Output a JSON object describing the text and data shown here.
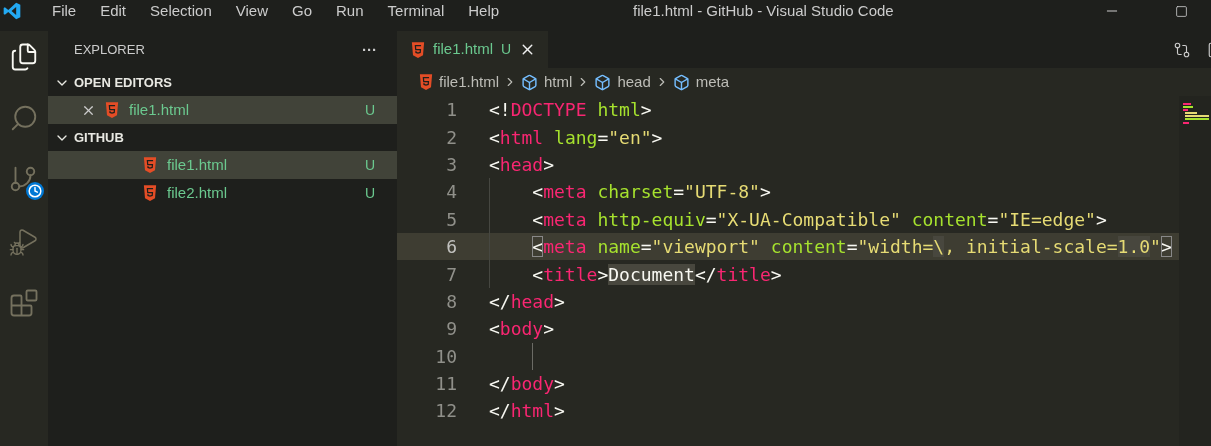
{
  "window": {
    "title": "file1.html - GitHub - Visual Studio Code"
  },
  "menu": [
    "File",
    "Edit",
    "Selection",
    "View",
    "Go",
    "Run",
    "Terminal",
    "Help"
  ],
  "activity_bar": [
    {
      "kind": "explorer",
      "selected": true
    },
    {
      "kind": "search",
      "selected": false
    },
    {
      "kind": "source_control",
      "selected": false
    },
    {
      "kind": "debug",
      "selected": false
    },
    {
      "kind": "extensions",
      "selected": false
    }
  ],
  "sidebar": {
    "title": "EXPLORER",
    "more": "···",
    "sections": [
      {
        "title": "OPEN EDITORS",
        "expanded": true,
        "items": [
          {
            "name": "file1.html",
            "status": "U",
            "closable": true,
            "selected": true
          }
        ]
      },
      {
        "title": "GITHUB",
        "expanded": true,
        "items": [
          {
            "name": "file1.html",
            "status": "U",
            "closable": false,
            "selected": true
          },
          {
            "name": "file2.html",
            "status": "U",
            "closable": false,
            "selected": false
          }
        ]
      }
    ]
  },
  "tabs": [
    {
      "label": "file1.html",
      "status": "U",
      "selected": true
    }
  ],
  "breadcrumb": [
    {
      "kind": "file",
      "label": "file1.html"
    },
    {
      "kind": "element",
      "label": "html"
    },
    {
      "kind": "element",
      "label": "head"
    },
    {
      "kind": "element",
      "label": "meta"
    }
  ],
  "lines": [
    {
      "number": "1",
      "current": false,
      "indented": false,
      "tokens": [
        {
          "kind": "punct",
          "text": "<!",
          "highlighted": false
        },
        {
          "kind": "tag",
          "text": "DOCTYPE",
          "highlighted": false
        },
        {
          "kind": "attr",
          "text": " html",
          "highlighted": false
        },
        {
          "kind": "punct",
          "text": ">",
          "highlighted": false
        }
      ]
    },
    {
      "number": "2",
      "current": false,
      "indented": false,
      "tokens": [
        {
          "kind": "punct",
          "text": "<",
          "highlighted": false
        },
        {
          "kind": "tag",
          "text": "html",
          "highlighted": false
        },
        {
          "kind": "attr",
          "text": " lang",
          "highlighted": false
        },
        {
          "kind": "punct",
          "text": "=",
          "highlighted": false
        },
        {
          "kind": "str",
          "text": "\"en\"",
          "highlighted": false
        },
        {
          "kind": "punct",
          "text": ">",
          "highlighted": false
        }
      ]
    },
    {
      "number": "3",
      "current": false,
      "indented": false,
      "tokens": [
        {
          "kind": "punct",
          "text": "<",
          "highlighted": false
        },
        {
          "kind": "tag",
          "text": "head",
          "highlighted": false
        },
        {
          "kind": "punct",
          "text": ">",
          "highlighted": false
        }
      ]
    },
    {
      "number": "4",
      "current": false,
      "indented": true,
      "tokens": [
        {
          "kind": "punct",
          "text": "<",
          "highlighted": false
        },
        {
          "kind": "tag",
          "text": "meta",
          "highlighted": false
        },
        {
          "kind": "attr",
          "text": " charset",
          "highlighted": false
        },
        {
          "kind": "punct",
          "text": "=",
          "highlighted": false
        },
        {
          "kind": "str",
          "text": "\"UTF-8\"",
          "highlighted": false
        },
        {
          "kind": "punct",
          "text": ">",
          "highlighted": false
        }
      ]
    },
    {
      "number": "5",
      "current": false,
      "indented": true,
      "tokens": [
        {
          "kind": "punct",
          "text": "<",
          "highlighted": false
        },
        {
          "kind": "tag",
          "text": "meta",
          "highlighted": false
        },
        {
          "kind": "attr",
          "text": " http-equiv",
          "highlighted": false
        },
        {
          "kind": "punct",
          "text": "=",
          "highlighted": false
        },
        {
          "kind": "str",
          "text": "\"X-UA-Compatible\"",
          "highlighted": false
        },
        {
          "kind": "attr",
          "text": " content",
          "highlighted": false
        },
        {
          "kind": "punct",
          "text": "=",
          "highlighted": false
        },
        {
          "kind": "str",
          "text": "\"IE=edge\"",
          "highlighted": false
        },
        {
          "kind": "punct",
          "text": ">",
          "highlighted": false
        }
      ]
    },
    {
      "number": "6",
      "current": true,
      "indented": true,
      "tokens": [
        {
          "kind": "bracket",
          "text": "<",
          "highlighted": false
        },
        {
          "kind": "tag",
          "text": "meta",
          "highlighted": false
        },
        {
          "kind": "attr",
          "text": " name",
          "highlighted": false
        },
        {
          "kind": "punct",
          "text": "=",
          "highlighted": false
        },
        {
          "kind": "str",
          "text": "\"viewport\"",
          "highlighted": false
        },
        {
          "kind": "attr",
          "text": " content",
          "highlighted": false
        },
        {
          "kind": "punct",
          "text": "=",
          "highlighted": false
        },
        {
          "kind": "str",
          "text": "\"width=",
          "highlighted": false
        },
        {
          "kind": "str",
          "text": "\\",
          "highlighted": true
        },
        {
          "kind": "str",
          "text": ", initial-scale=",
          "highlighted": false
        },
        {
          "kind": "str",
          "text": "1.0",
          "highlighted": true
        },
        {
          "kind": "str",
          "text": "\"",
          "highlighted": false
        },
        {
          "kind": "bracket",
          "text": ">",
          "highlighted": false
        }
      ]
    },
    {
      "number": "7",
      "current": false,
      "indented": true,
      "tokens": [
        {
          "kind": "punct",
          "text": "<",
          "highlighted": false
        },
        {
          "kind": "tag",
          "text": "title",
          "highlighted": false
        },
        {
          "kind": "punct",
          "text": ">",
          "highlighted": false
        },
        {
          "kind": "text",
          "text": "Document",
          "highlighted": true
        },
        {
          "kind": "punct",
          "text": "</",
          "highlighted": false
        },
        {
          "kind": "tag",
          "text": "title",
          "highlighted": false
        },
        {
          "kind": "punct",
          "text": ">",
          "highlighted": false
        }
      ]
    },
    {
      "number": "8",
      "current": false,
      "indented": false,
      "tokens": [
        {
          "kind": "punct",
          "text": "</",
          "highlighted": false
        },
        {
          "kind": "tag",
          "text": "head",
          "highlighted": false
        },
        {
          "kind": "punct",
          "text": ">",
          "highlighted": false
        }
      ]
    },
    {
      "number": "9",
      "current": false,
      "indented": false,
      "tokens": [
        {
          "kind": "punct",
          "text": "<",
          "highlighted": false
        },
        {
          "kind": "tag",
          "text": "body",
          "highlighted": false
        },
        {
          "kind": "punct",
          "text": ">",
          "highlighted": false
        }
      ]
    },
    {
      "number": "10",
      "current": false,
      "indented": true
    },
    {
      "number": "11",
      "current": false,
      "indented": false,
      "tokens": [
        {
          "kind": "punct",
          "text": "</",
          "highlighted": false
        },
        {
          "kind": "tag",
          "text": "body",
          "highlighted": false
        },
        {
          "kind": "punct",
          "text": ">",
          "highlighted": false
        }
      ]
    },
    {
      "number": "12",
      "current": false,
      "indented": false,
      "tokens": [
        {
          "kind": "punct",
          "text": "</",
          "highlighted": false
        },
        {
          "kind": "tag",
          "text": "html",
          "highlighted": false
        },
        {
          "kind": "punct",
          "text": ">",
          "highlighted": false
        }
      ]
    }
  ]
}
